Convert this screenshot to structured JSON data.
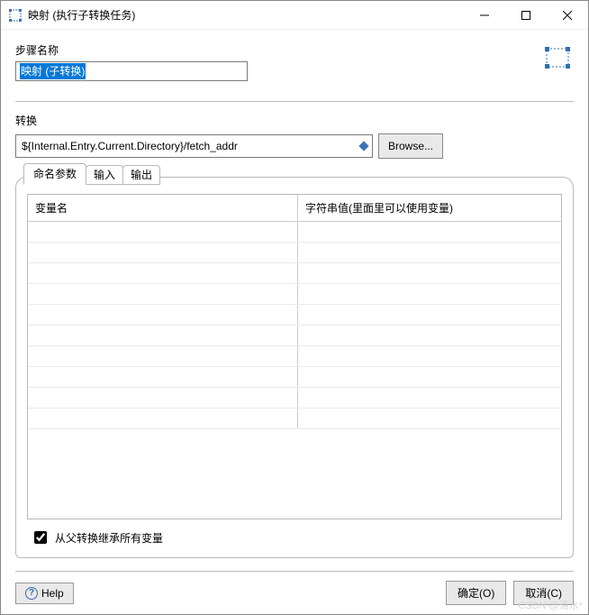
{
  "window": {
    "title": "映射 (执行子转换任务)"
  },
  "step": {
    "label": "步骤名称",
    "value": "映射 (子转换)"
  },
  "transform": {
    "label": "转换",
    "value": "${Internal.Entry.Current.Directory}/fetch_addr",
    "browse_label": "Browse..."
  },
  "tabs": {
    "t0": "命名参数",
    "t1": "输入",
    "t2": "输出"
  },
  "grid": {
    "col0": "变量名",
    "col1": "字符串值(里面里可以使用变量)"
  },
  "inherit": {
    "label": "从父转换继承所有变量",
    "checked": true
  },
  "footer": {
    "help": "Help",
    "ok": "确定(O)",
    "cancel": "取消(C)"
  },
  "watermark": "CSDN @清水*"
}
